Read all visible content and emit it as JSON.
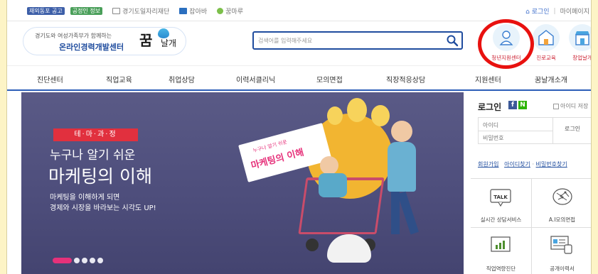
{
  "util_bar": {
    "badge_1": "재외동포 공고",
    "badge_2": "공정인 정보",
    "sites": [
      "경기도일자리재단",
      "잡아바",
      "꿈마루"
    ],
    "login": "로그인",
    "mypage": "마이페이지"
  },
  "header": {
    "logo_tagline": "경기도와 여성가족부가 함께하는",
    "logo_name": "온라인경력개발센터",
    "logo_mark": "꿈",
    "logo_mark2": "날개",
    "search_placeholder": "검색어를 입력해주세요",
    "quick_menus": [
      {
        "label": "청년지원센터",
        "icon": "young-person-icon"
      },
      {
        "label": "진로교육",
        "icon": "school-building-icon"
      },
      {
        "label": "창업날개",
        "icon": "storefront-icon"
      }
    ]
  },
  "nav": {
    "items": [
      "진단센터",
      "직업교육",
      "취업상담",
      "이력서클리닉",
      "모의면접",
      "직장적응상담",
      "지원센터",
      "꿈날개소개"
    ]
  },
  "banner": {
    "tag": "테·마·과·정",
    "title_line1": "누구나 알기 쉬운",
    "title_line2": "마케팅의 이해",
    "desc_line1": "마케팅을 이해하게 되면",
    "desc_line2": "경제와 시장을 바라보는 시각도 UP!",
    "sign_small": "누구나 알기 쉬운",
    "sign_big": "마케팅의 이해",
    "slide_count": 5,
    "active_slide": 1
  },
  "login": {
    "title": "로그인",
    "sns": [
      "f",
      "N"
    ],
    "save_id": "아이디 저장",
    "id_placeholder": "아이디",
    "pw_placeholder": "비밀번호",
    "button": "로그인",
    "signup": "회원가입",
    "find_id": "아이디찾기",
    "find_pw": "비밀번호찾기"
  },
  "services": [
    {
      "label": "실시간 상담서비스",
      "icon": "talk-bubble-icon"
    },
    {
      "label": "A.I모의면접",
      "icon": "ai-brain-icon"
    },
    {
      "label": "직업역량진단",
      "icon": "bar-chart-icon"
    },
    {
      "label": "공개이력서",
      "icon": "resume-monitor-icon"
    }
  ],
  "colors": {
    "brand_blue": "#1f4c9e",
    "accent_red": "#e1303e",
    "highlight_ring": "#e8110f",
    "banner_bg": "#52527f",
    "page_bg": "#fdf4c6"
  }
}
